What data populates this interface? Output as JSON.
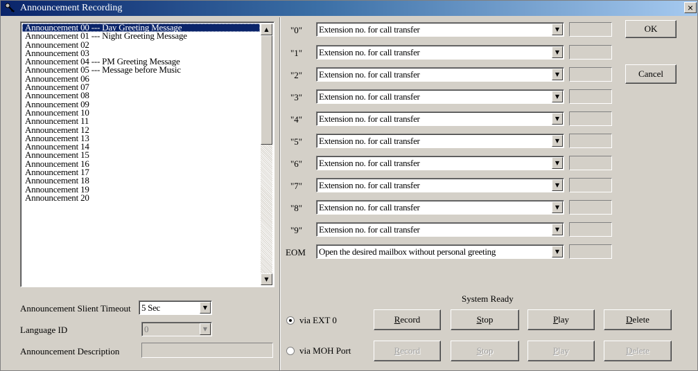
{
  "window": {
    "title": "Announcement Recording",
    "close_label": "×"
  },
  "announcements": [
    "Announcement 00 --- Day Greeting Message",
    "Announcement 01 --- Night Greeting Message",
    "Announcement 02",
    "Announcement 03",
    "Announcement 04 --- PM Greeting Message",
    "Announcement 05 --- Message before Music",
    "Announcement 06",
    "Announcement 07",
    "Announcement 08",
    "Announcement 09",
    "Announcement 10",
    "Announcement 11",
    "Announcement 12",
    "Announcement 13",
    "Announcement 14",
    "Announcement 15",
    "Announcement 16",
    "Announcement 17",
    "Announcement 18",
    "Announcement 19",
    "Announcement 20"
  ],
  "selected_index": 0,
  "scroll": {
    "up_icon": "▲",
    "down_icon": "▼"
  },
  "settings": {
    "timeout_label": "Announcement Slient Timeout",
    "timeout_value": "5 Sec",
    "language_label": "Language ID",
    "language_value": "0",
    "description_label": "Announcement Description",
    "description_value": ""
  },
  "keys": [
    {
      "key": "\"0\"",
      "action": "Extension no. for call transfer",
      "value": ""
    },
    {
      "key": "\"1\"",
      "action": "Extension no. for call transfer",
      "value": ""
    },
    {
      "key": "\"2\"",
      "action": "Extension no. for call transfer",
      "value": ""
    },
    {
      "key": "\"3\"",
      "action": "Extension no. for call transfer",
      "value": ""
    },
    {
      "key": "\"4\"",
      "action": "Extension no. for call transfer",
      "value": ""
    },
    {
      "key": "\"5\"",
      "action": "Extension no. for call transfer",
      "value": ""
    },
    {
      "key": "\"6\"",
      "action": "Extension no. for call transfer",
      "value": ""
    },
    {
      "key": "\"7\"",
      "action": "Extension no. for call transfer",
      "value": ""
    },
    {
      "key": "\"8\"",
      "action": "Extension no. for call transfer",
      "value": ""
    },
    {
      "key": "\"9\"",
      "action": "Extension no. for call transfer",
      "value": ""
    },
    {
      "key": "EOM",
      "action": "Open the desired mailbox without personal greeting",
      "value": ""
    }
  ],
  "dropdown_icon": "▼",
  "buttons": {
    "ok": "OK",
    "cancel": "Cancel"
  },
  "status": "System Ready",
  "recording": {
    "ext": {
      "label": "via EXT 0",
      "selected": true,
      "record_u": "R",
      "record_rest": "ecord",
      "stop_u": "S",
      "stop_rest": "top",
      "play_u": "P",
      "play_rest": "lay",
      "delete_u": "D",
      "delete_rest": "elete"
    },
    "moh": {
      "label": "via MOH Port",
      "selected": false,
      "record_u": "R",
      "record_rest": "ecord",
      "stop_u": "S",
      "stop_rest": "top",
      "play_u": "P",
      "play_rest": "lay",
      "delete_u": "D",
      "delete_rest": "elete"
    }
  }
}
